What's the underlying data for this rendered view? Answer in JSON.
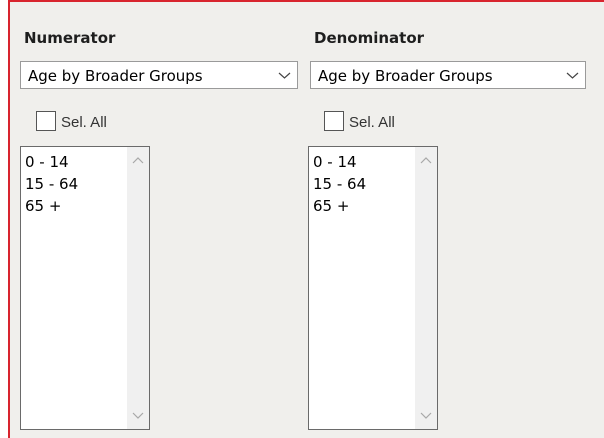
{
  "numerator": {
    "heading": "Numerator",
    "dropdown_value": "Age by Broader Groups",
    "select_all_label": "Sel. All",
    "select_all_checked": false,
    "items": [
      "0 - 14",
      "15 - 64",
      "65 +"
    ]
  },
  "denominator": {
    "heading": "Denominator",
    "dropdown_value": "Age by Broader Groups",
    "select_all_label": "Sel. All",
    "select_all_checked": false,
    "items": [
      "0 - 14",
      "15 - 64",
      "65 +"
    ]
  },
  "colors": {
    "panel_background": "#f0efec",
    "panel_border": "#d8242e"
  },
  "icons": {
    "dropdown": "chevron-down-icon",
    "scroll_up": "scroll-up-arrow-icon",
    "scroll_down": "scroll-down-arrow-icon"
  }
}
